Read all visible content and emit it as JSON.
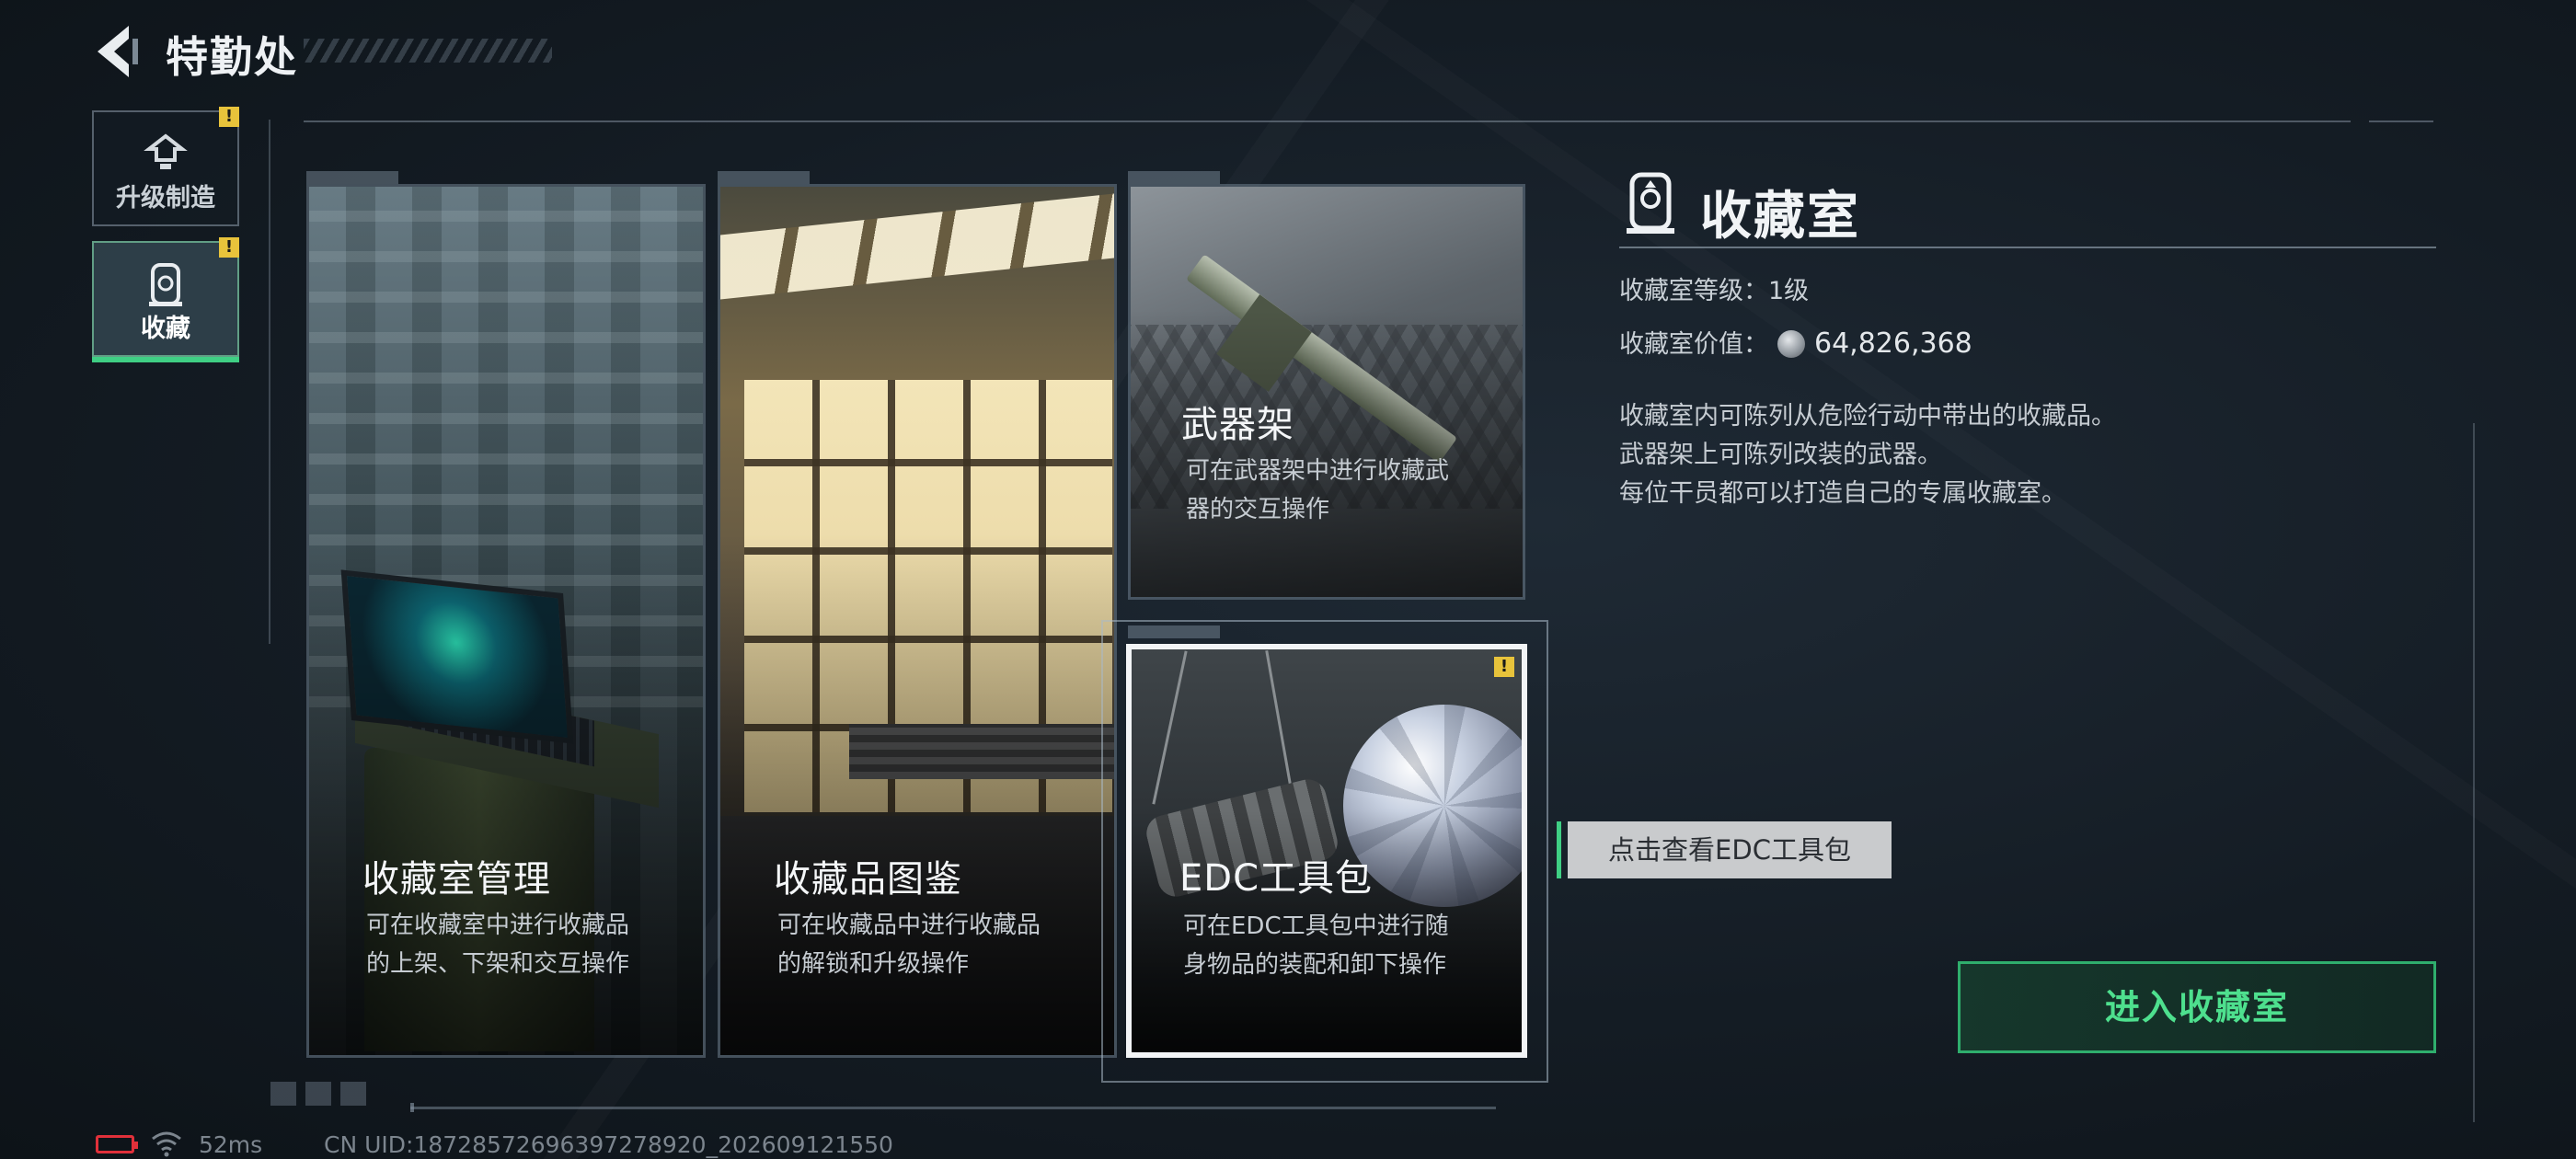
{
  "header": {
    "title": "特勤处",
    "back_icon": "chevron-left-icon"
  },
  "sidebar": {
    "items": [
      {
        "label": "升级制造",
        "icon": "upgrade-craft-icon",
        "alert": "!",
        "active": false
      },
      {
        "label": "收藏",
        "icon": "collection-room-icon",
        "alert": "!",
        "active": true
      }
    ]
  },
  "cards": [
    {
      "title": "收藏室管理",
      "desc_line1": "可在收藏室中进行收藏品",
      "desc_line2": "的上架、下架和交互操作"
    },
    {
      "title": "收藏品图鉴",
      "desc_line1": "可在收藏品中进行收藏品",
      "desc_line2": "的解锁和升级操作"
    },
    {
      "title": "武器架",
      "desc_line1": "可在武器架中进行收藏武",
      "desc_line2": "器的交互操作"
    },
    {
      "title": "EDC工具包",
      "desc_line1": "可在EDC工具包中进行随",
      "desc_line2": "身物品的装配和卸下操作",
      "alert": "!",
      "selected": true
    }
  ],
  "tooltip": "点击查看EDC工具包",
  "panel": {
    "title": "收藏室",
    "level_label": "收藏室等级：",
    "level_value": "1级",
    "value_label": "收藏室价值：",
    "value_amount": "64,826,368",
    "description": [
      "收藏室内可陈列从危险行动中带出的收藏品。",
      "武器架上可陈列改装的武器。",
      "每位干员都可以打造自己的专属收藏室。"
    ],
    "enter_button": "进入收藏室"
  },
  "status_bar": {
    "ping": "52ms",
    "uid": "CN UID:18728572696397278920_202609121550"
  },
  "colors": {
    "accent_green": "#3fcf84",
    "alert_yellow": "#e8c33b",
    "battery_red": "#e0303a"
  }
}
